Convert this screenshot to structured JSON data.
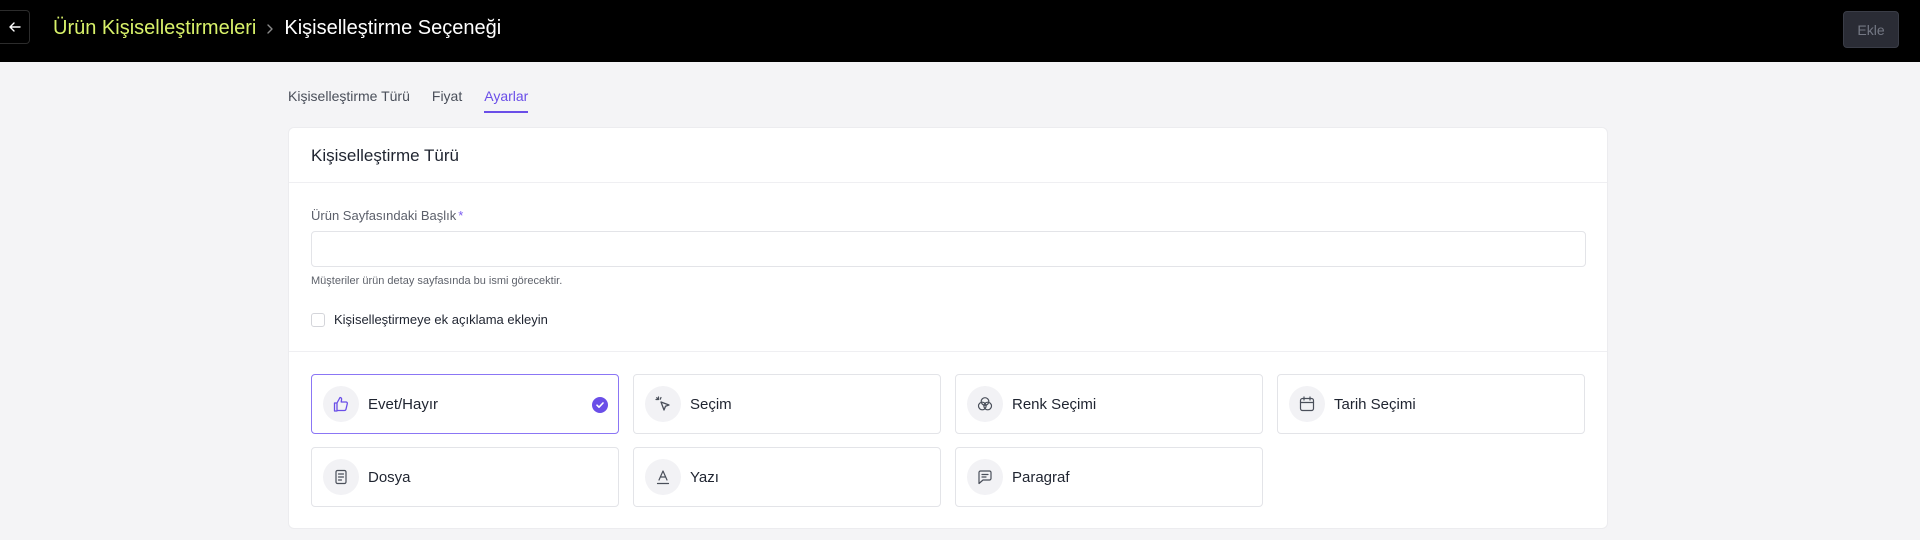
{
  "header": {
    "breadcrumb_parent": "Ürün Kişiselleştirmeleri",
    "breadcrumb_current": "Kişiselleştirme Seçeneği",
    "add_label": "Ekle"
  },
  "tabs": [
    {
      "label": "Kişiselleştirme Türü",
      "active": false
    },
    {
      "label": "Fiyat",
      "active": false
    },
    {
      "label": "Ayarlar",
      "active": true
    }
  ],
  "card": {
    "title": "Kişiselleştirme Türü",
    "field_label": "Ürün Sayfasındaki Başlık",
    "required_mark": "*",
    "field_value": "",
    "field_placeholder": "",
    "helper_text": "Müşteriler ürün detay sayfasında bu ismi görecektir.",
    "checkbox_label": "Kişiselleştirmeye ek açıklama ekleyin",
    "checkbox_checked": false
  },
  "options": [
    {
      "label": "Evet/Hayır",
      "icon": "thumbs-up-icon",
      "selected": true
    },
    {
      "label": "Seçim",
      "icon": "cursor-click-icon",
      "selected": false
    },
    {
      "label": "Renk Seçimi",
      "icon": "color-circles-icon",
      "selected": false
    },
    {
      "label": "Tarih Seçimi",
      "icon": "calendar-icon",
      "selected": false
    },
    {
      "label": "Dosya",
      "icon": "file-icon",
      "selected": false
    },
    {
      "label": "Yazı",
      "icon": "text-icon",
      "selected": false
    },
    {
      "label": "Paragraf",
      "icon": "message-icon",
      "selected": false
    }
  ],
  "colors": {
    "accent": "#6a4ee8",
    "breadcrumb_link": "#d9f26a",
    "topbar": "#000000"
  }
}
